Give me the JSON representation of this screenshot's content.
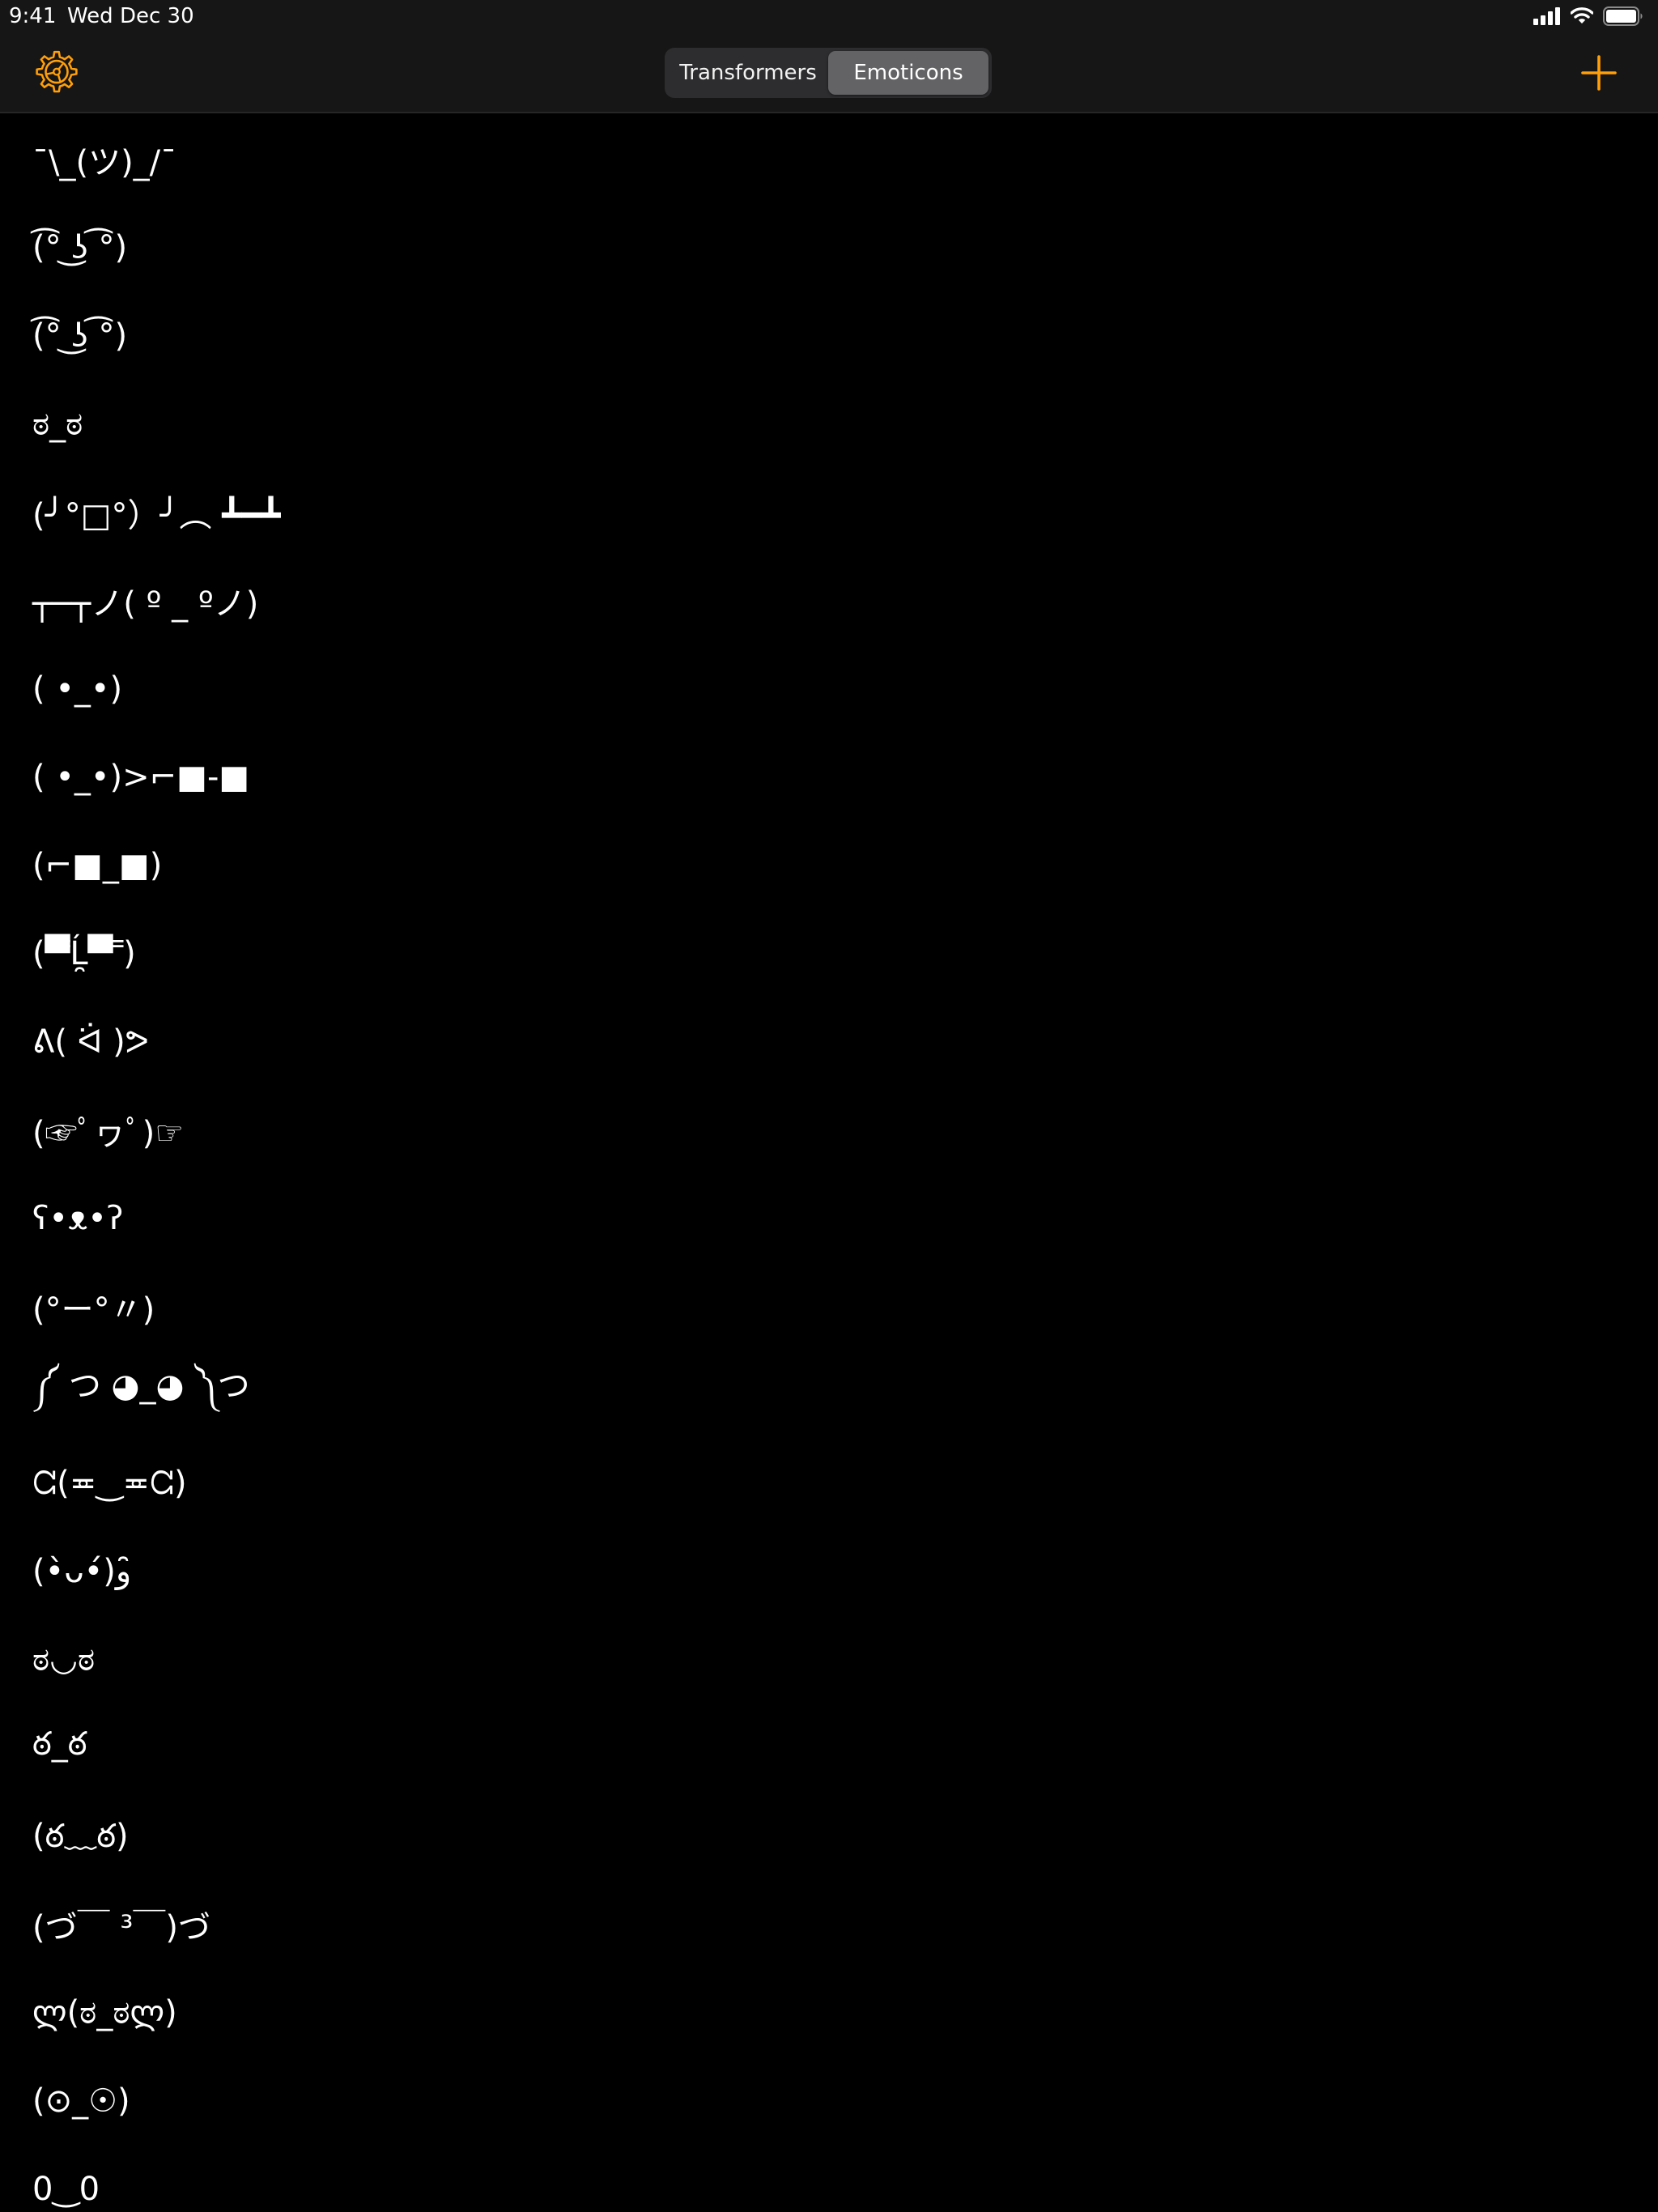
{
  "status_bar": {
    "time": "9:41",
    "date": "Wed Dec 30"
  },
  "nav": {
    "settings_icon": "gear-icon",
    "add_icon": "plus-icon",
    "accent_color": "#ff9f0a",
    "segments": [
      {
        "label": "Transformers",
        "selected": false
      },
      {
        "label": "Emoticons",
        "selected": true
      }
    ]
  },
  "emoticons": [
    "¯\\_(ツ)_/¯",
    "(͡° ͜ʖ ͡°)",
    "(͡° ͜ʖ ͡°)",
    "ಠ_ಠ",
    "(╯°□°）╯︵ ┻━┻",
    "┬─┬ノ( º _ ºノ)",
    "( •_•)",
    "( •_•)>⌐■-■",
    "(⌐■_■)",
    "(▀̿Ĺ̯▀̿ ̿)",
    "ᕕ( ᐛ )ᕗ",
    "(☞ﾟヮﾟ)☞",
    "ʕ•ᴥ•ʔ",
    "(°ー°〃)",
    "༼ つ ◕_◕ ༽つ",
    "ᘳ(≖‿≖ᘳ)",
    "(•̀ᴗ•́)و ̑̑",
    "ಠ◡ಠ",
    "ఠ_ఠ",
    "(ఠ﹏ఠ)",
    "(づ￣ ³￣)づ",
    "ლ(ಠ_ಠლ)",
    "(⊙_☉)",
    "0‿0"
  ]
}
